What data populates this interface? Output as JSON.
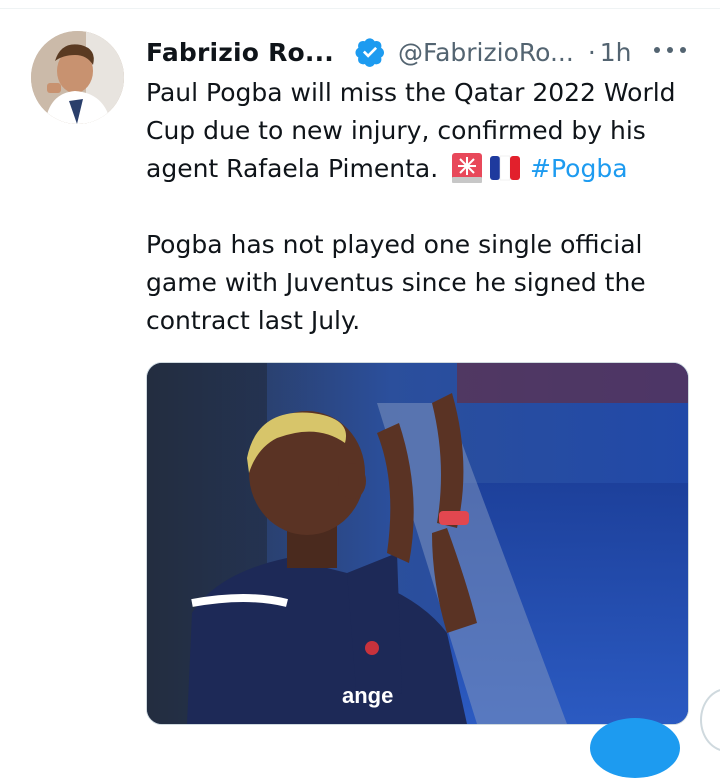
{
  "tweet": {
    "display_name": "Fabrizio Ro...",
    "handle": "@FabrizioRo...",
    "separator": "·",
    "time": "1h",
    "lines_p1_a": "Paul Pogba will miss the Qatar 2022 World",
    "lines_p1_b": "Cup due to new injury, confirmed by his",
    "lines_p1_c": "agent Rafaela Pimenta.",
    "hashtag": "#Pogba",
    "lines_p2_a": "Pogba has not played one single official",
    "lines_p2_b": "game with Juventus since he signed the",
    "lines_p2_c": "contract last July.",
    "emojis": [
      "siren-emoji",
      "france-flag-emoji"
    ],
    "media_alt_text": "ange"
  },
  "colors": {
    "text": "#0f1419",
    "secondary": "#536471",
    "accent": "#1d9bf0",
    "verified": "#1d9bf0"
  }
}
